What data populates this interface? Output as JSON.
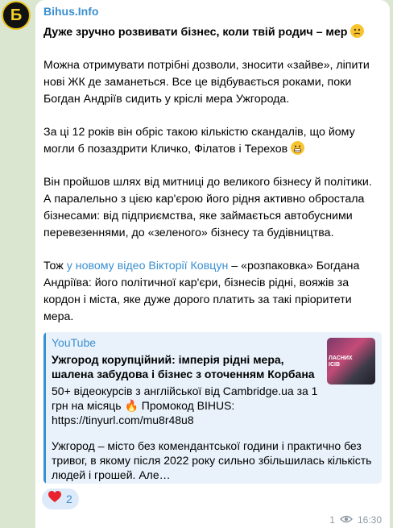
{
  "channel": {
    "name": "Bihus.Info",
    "avatar_letter": "Б"
  },
  "message": {
    "title": "Дуже зручно розвивати бізнес, коли твій родич – мер",
    "p1": "Можна отримувати потрібні дозволи, зносити «зайве», ліпити нові ЖК де заманеться. Все це відбувається роками, поки Богдан Андріїв сидить у кріслі мера Ужгорода.",
    "p2": "За ці 12 років він обріс такою кількістю скандалів, що йому могли б позаздрити Кличко, Філатов і Терехов",
    "p3": "Він пройшов шлях від митниці до великого бізнесу й політики. А паралельно з цією кар'єрою його рідня активно обростала бізнесами: від підприємства, яке займається автобусними перевезеннями, до «зеленого» бізнесу та будівництва.",
    "p4_prefix": "Тож ",
    "p4_link": "у новому відео Вікторії Ковцун",
    "p4_suffix": " – «розпаковка» Богдана Андріїва: його політичної кар'єри, бізнесів рідні, вояжів за кордон і міста, яке дуже дорого платить за такі пріоритети мера."
  },
  "preview": {
    "site": "YouTube",
    "title": "Ужгород корупційний: імперія рідні мера, шалена забудова і бізнес з оточенням Корбана",
    "desc": "50+ відеокурсів з англійської від Cambridge.ua за 1 грн на місяць 🔥 Промокод BIHUS: https://tinyurl.com/mu8r48u8",
    "desc2": "Ужгород – місто без комендантської години і практично без тривог, в якому після 2022 року сильно збільшилась кількість людей і грошей. Але…",
    "thumb_text": "ЛАСНИХ\nІСІВ"
  },
  "reaction": {
    "emoji": "❤️",
    "count": "2"
  },
  "meta": {
    "views": "1",
    "time": "16:30"
  },
  "colors": {
    "accent": "#3a8fd0",
    "background": "#dbe6d0",
    "preview_bg": "#e9f2fb"
  }
}
